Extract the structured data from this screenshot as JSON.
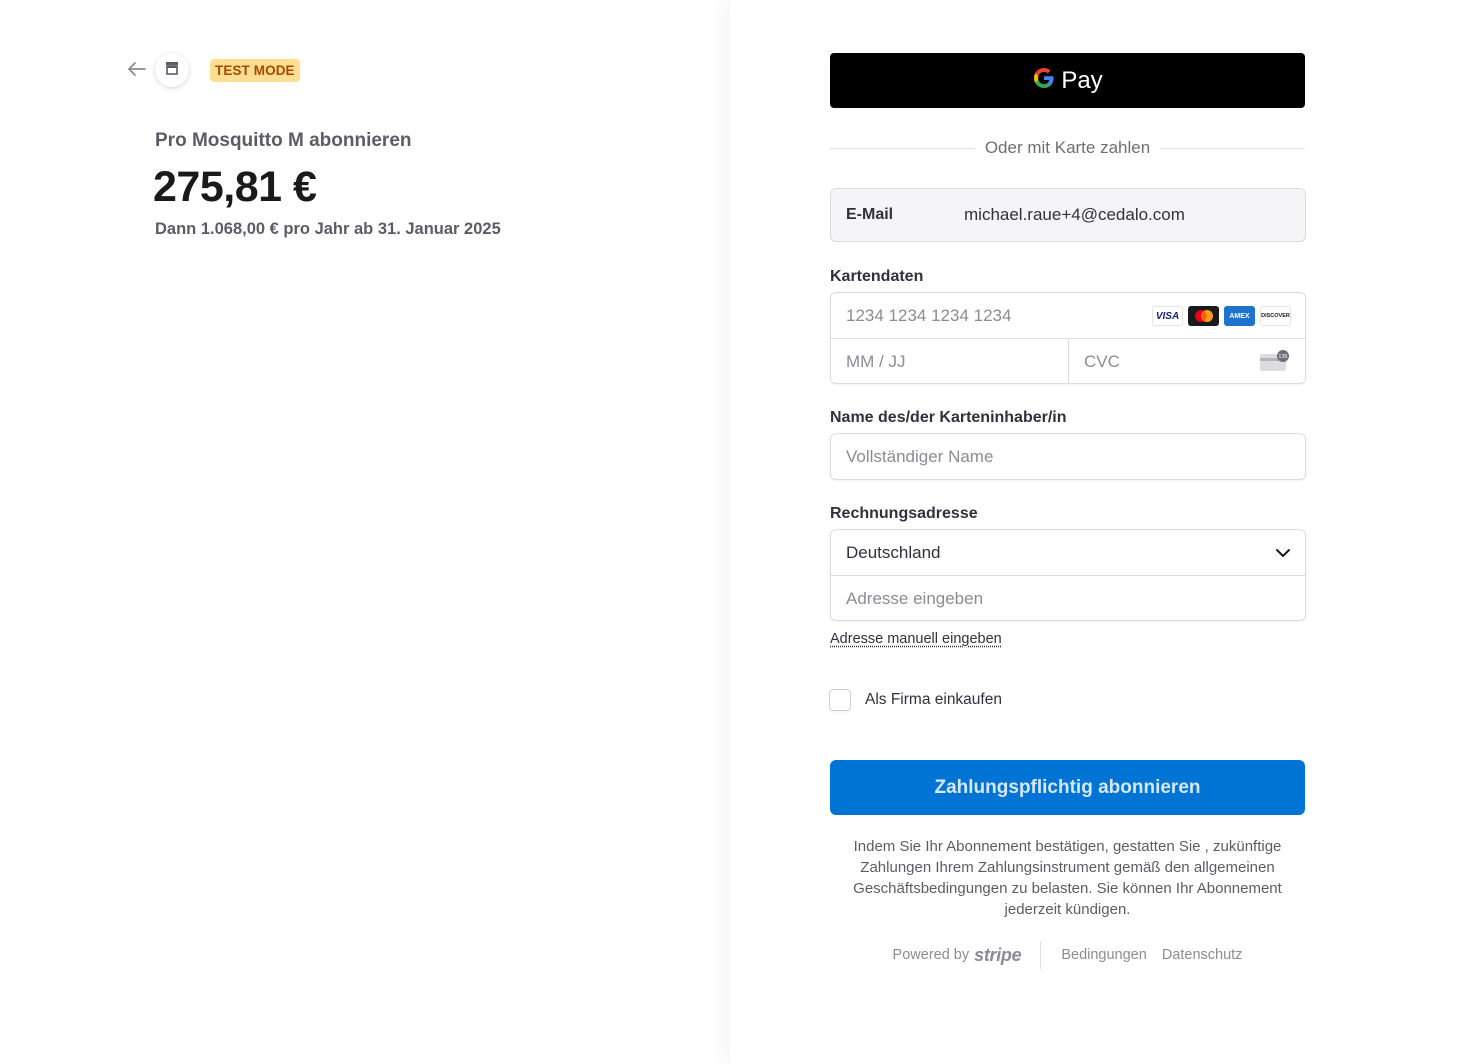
{
  "summary": {
    "badge": "TEST MODE",
    "product_name": "Pro Mosquitto M abonnieren",
    "price": "275,81 €",
    "price_sub": "Dann 1.068,00 € pro Jahr ab 31. Januar 2025"
  },
  "payment": {
    "gpay_label": "Pay",
    "divider_text": "Oder mit Karte zahlen",
    "email_label": "E-Mail",
    "email_value": "michael.raue+4@cedalo.com",
    "card_label": "Kartendaten",
    "card_number_placeholder": "1234 1234 1234 1234",
    "card_brands": [
      "VISA",
      "mastercard",
      "AMEX",
      "DISCOVER"
    ],
    "expiry_placeholder": "MM / JJ",
    "cvc_placeholder": "CVC",
    "cvc_icon_text": "135",
    "name_label": "Name des/der Karteninhaber/in",
    "name_placeholder": "Vollständiger Name",
    "address_label": "Rechnungsadresse",
    "country_value": "Deutschland",
    "address_placeholder": "Adresse eingeben",
    "manual_address_link": "Adresse manuell eingeben",
    "business_checkbox_label": "Als Firma einkaufen",
    "submit_label": "Zahlungspflichtig abonnieren",
    "terms_text": "Indem Sie Ihr Abonnement bestätigen, gestatten Sie , zukünftige Zahlungen Ihrem Zahlungsinstrument gemäß den allgemeinen Geschäftsbedingungen zu belasten. Sie können Ihr Abonnement jederzeit kündigen."
  },
  "footer": {
    "powered_by": "Powered by",
    "stripe_word": "stripe",
    "terms_link": "Bedingungen",
    "privacy_link": "Datenschutz"
  },
  "colors": {
    "primary_button": "#0074d4",
    "test_badge_bg": "#ffde92",
    "test_badge_text": "#a34b00",
    "gpay_bg": "#000000"
  },
  "icons": {
    "back": "arrow-left-icon",
    "store": "store-icon",
    "gpay": "google-g-icon",
    "chevron": "chevron-down-icon",
    "cvc": "card-cvc-icon"
  }
}
